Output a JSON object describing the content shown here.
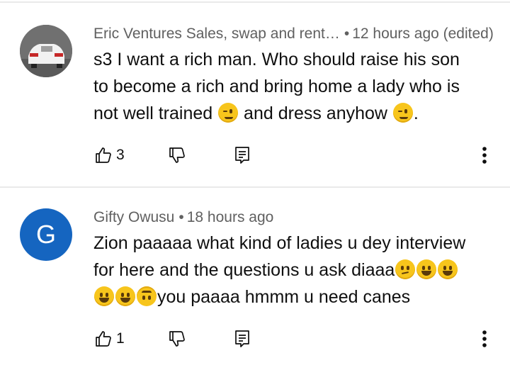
{
  "comments": [
    {
      "author": "Eric Ventures Sales, swap and rent…",
      "time": "12 hours ago (edited)",
      "lines": [
        {
          "text": "s3 I want a rich man. Who should raise his son",
          "emojis": []
        },
        {
          "text": "to become a  rich and bring home a lady who is",
          "emojis": []
        },
        {
          "segments": [
            "not well trained ",
            "wink",
            " and dress anyhow ",
            "wink",
            "."
          ]
        }
      ],
      "likes": "3",
      "avatar": "car-photo"
    },
    {
      "author": "Gifty Owusu",
      "time": "18 hours ago",
      "avatar_letter": "G",
      "avatar_color": "#1565c0",
      "lines": [
        {
          "text": "Zion paaaaa what kind of ladies  u dey interview"
        },
        {
          "segments": [
            "for here and the questions  u ask diaaa",
            "think",
            "grin",
            "grin"
          ]
        },
        {
          "segments": [
            "grin",
            "grin",
            "upside",
            "you paaaa hmmm u need canes"
          ]
        }
      ],
      "likes": "1"
    }
  ],
  "icons": {
    "like": "thumbs-up-icon",
    "dislike": "thumbs-down-icon",
    "reply": "reply-icon",
    "more": "more-vertical-icon"
  }
}
